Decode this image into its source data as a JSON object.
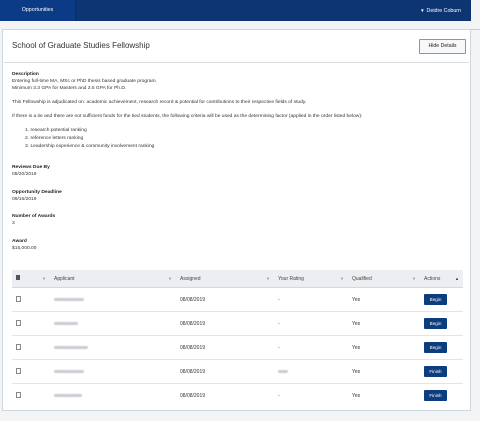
{
  "nav": {
    "tab": "Opportunities",
    "user": "Deidre Coburn"
  },
  "page": {
    "title": "School of Graduate Studies Fellowship",
    "hide_details": "Hide Details"
  },
  "details": {
    "description_label": "Description",
    "description_line1": "Entering full-time MA, MSc or PhD thesis based graduate program.",
    "description_line2": "Minimum 3.3 GPA for Masters and 3.5 GPA for Ph.D.",
    "adjudication": "This Fellowship is adjudicated on: academic achievement, research record & potential for contributions to their respective fields of study.",
    "tie_note": "If there is a tie and there are not sufficient funds for the tied students, the following criteria will be used as the determining factor (applied in the order listed below):",
    "criteria": [
      "1. research potential ranking",
      "2. reference letters ranking",
      "3. Leadership experience & community involvement ranking"
    ],
    "reviews_due_label": "Reviews Due By",
    "reviews_due": "09/20/2019",
    "deadline_label": "Opportunity Deadline",
    "deadline": "09/15/2019",
    "awards_label": "Number of Awards",
    "awards": "3",
    "award_label": "Award",
    "award": "$15,000.00"
  },
  "table": {
    "headers": {
      "applicant": "Applicant",
      "assigned": "Assigned",
      "rating": "Your Rating",
      "qualified": "Qualified",
      "actions": "Actions"
    },
    "rows": [
      {
        "assigned": "08/08/2019",
        "rating": "-",
        "qualified": "Yes",
        "action": "Begin"
      },
      {
        "assigned": "08/08/2019",
        "rating": "-",
        "qualified": "Yes",
        "action": "Begin"
      },
      {
        "assigned": "08/08/2019",
        "rating": "-",
        "qualified": "Yes",
        "action": "Begin"
      },
      {
        "assigned": "08/08/2019",
        "rating": "",
        "qualified": "Yes",
        "action": "Finish"
      },
      {
        "assigned": "08/08/2019",
        "rating": "-",
        "qualified": "Yes",
        "action": "Finish"
      }
    ]
  }
}
